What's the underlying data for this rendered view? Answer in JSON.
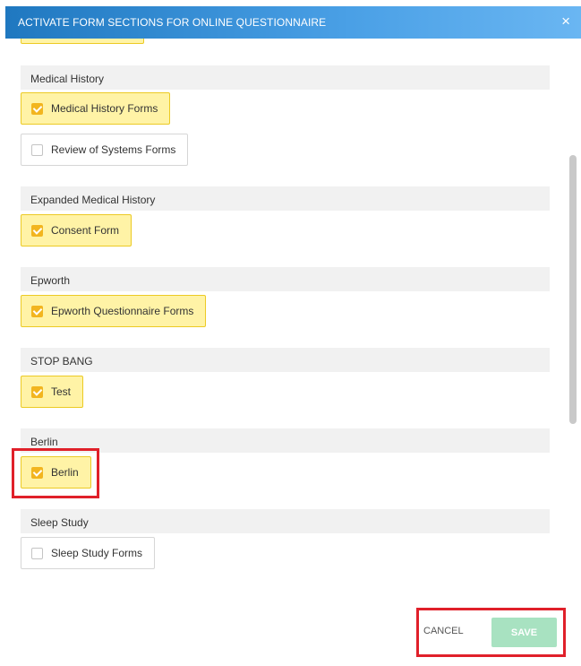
{
  "dialog": {
    "title": "ACTIVATE FORM SECTIONS FOR ONLINE QUESTIONNAIRE",
    "close_symbol": "×"
  },
  "sections": [
    {
      "label": "Medical History",
      "options": [
        {
          "label": "Medical History Forms",
          "checked": true
        },
        {
          "label": "Review of Systems Forms",
          "checked": false
        }
      ]
    },
    {
      "label": "Expanded Medical History",
      "options": [
        {
          "label": "Consent Form",
          "checked": true
        }
      ]
    },
    {
      "label": "Epworth",
      "options": [
        {
          "label": "Epworth Questionnaire Forms",
          "checked": true
        }
      ]
    },
    {
      "label": "STOP BANG",
      "options": [
        {
          "label": "Test",
          "checked": true
        }
      ]
    },
    {
      "label": "Berlin",
      "options": [
        {
          "label": "Berlin",
          "checked": true
        }
      ]
    },
    {
      "label": "Sleep Study",
      "options": [
        {
          "label": "Sleep Study Forms",
          "checked": false
        }
      ]
    }
  ],
  "footer": {
    "cancel_label": "CANCEL",
    "save_label": "SAVE"
  },
  "colors": {
    "header_start": "#1f78c0",
    "header_end": "#6ab6f2",
    "checked_bg": "#fff3a6",
    "checkbox_on": "#f2b51f",
    "save_bg": "#a8e2c1",
    "highlight": "#e0202a"
  }
}
